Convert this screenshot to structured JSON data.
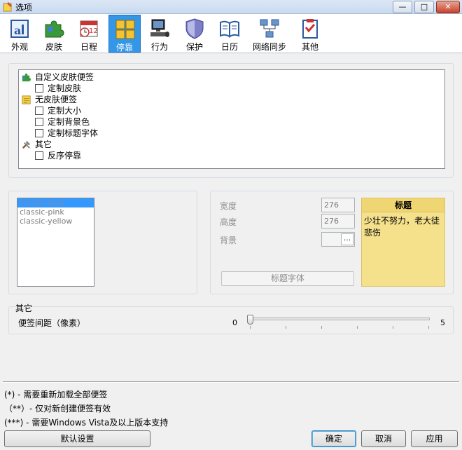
{
  "window": {
    "title": "选项",
    "controls": {
      "minimize": "—",
      "maximize": "□",
      "close": "✕"
    }
  },
  "toolbar": {
    "tabs": [
      {
        "label": "外观",
        "icon": "appearance-icon",
        "active": false
      },
      {
        "label": "皮肤",
        "icon": "puzzle-icon",
        "active": false
      },
      {
        "label": "日程",
        "icon": "calendar-clock-icon",
        "active": false
      },
      {
        "label": "停靠",
        "icon": "grid-dock-icon",
        "active": true
      },
      {
        "label": "行为",
        "icon": "computer-icon",
        "active": false
      },
      {
        "label": "保护",
        "icon": "shield-icon",
        "active": false
      },
      {
        "label": "日历",
        "icon": "book-icon",
        "active": false
      },
      {
        "label": "网络同步",
        "icon": "network-icon",
        "active": false
      },
      {
        "label": "其他",
        "icon": "checklist-icon",
        "active": false
      }
    ]
  },
  "tree": {
    "groups": [
      {
        "label": "自定义皮肤便签",
        "icon": "puzzle-icon",
        "items": [
          "定制皮肤"
        ]
      },
      {
        "label": "无皮肤便签",
        "icon": "note-icon",
        "items": [
          "定制大小",
          "定制背景色",
          "定制标题字体"
        ]
      },
      {
        "label": "其它",
        "icon": "tools-icon",
        "items": [
          "反序停靠"
        ]
      }
    ]
  },
  "skins": {
    "items": [
      "classic-blue",
      "classic-pink",
      "classic-yellow"
    ],
    "selected": "classic-blue"
  },
  "size_settings": {
    "width_label": "宽度",
    "width_value": "276",
    "height_label": "高度",
    "height_value": "276",
    "background_label": "背景",
    "background_button": "...",
    "title_font_button": "标题字体"
  },
  "preview": {
    "title": "标题",
    "body": "少壮不努力，老大徒悲伤",
    "color": "#f5e08c"
  },
  "other": {
    "section_label": "其它",
    "spacing_label": "便签间距（像素）",
    "slider_min": "0",
    "slider_max": "5",
    "slider_value": 0
  },
  "notes": [
    "(*) - 需要重新加载全部便签",
    "（**）- 仅对新创建便签有效",
    "(***) - 需要Windows Vista及以上版本支持"
  ],
  "buttons": {
    "reset": "默认设置",
    "ok": "确定",
    "cancel": "取消",
    "apply": "应用"
  }
}
